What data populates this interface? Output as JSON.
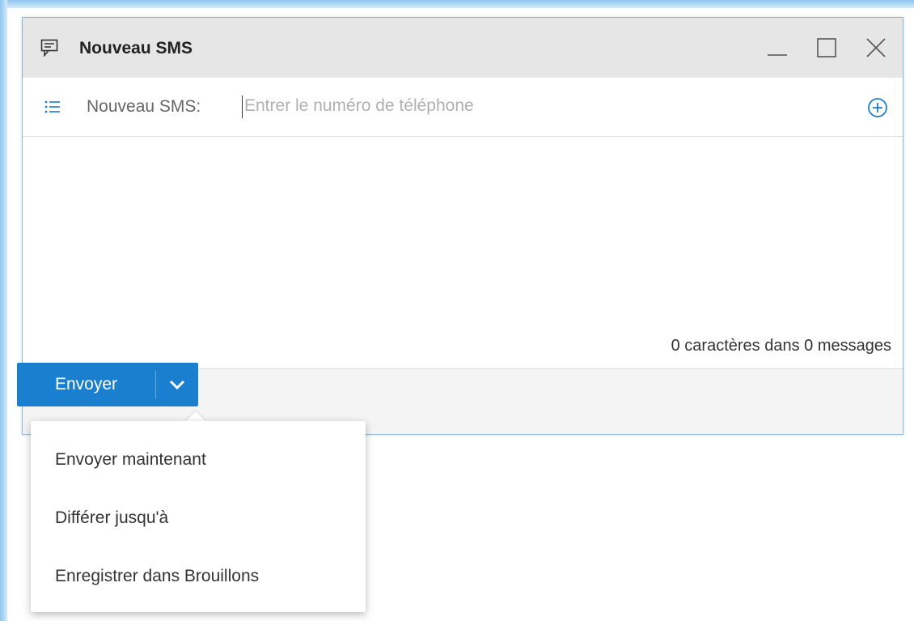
{
  "window": {
    "title": "Nouveau SMS",
    "title_icon": "sms-icon",
    "controls": [
      "minimize-icon",
      "maximize-icon",
      "close-icon"
    ]
  },
  "recipient": {
    "label": "Nouveau SMS:",
    "placeholder": "Entrer le numéro de téléphone",
    "value": "",
    "list_icon": "list-icon",
    "add_icon": "add-circle-icon"
  },
  "message": {
    "char_count": "0 caractères dans 0 messages"
  },
  "footer": {
    "send_label": "Envoyer",
    "dropdown_icon": "chevron-down-icon"
  },
  "send_menu": {
    "items": [
      {
        "label": "Envoyer maintenant"
      },
      {
        "label": "Différer jusqu'à"
      },
      {
        "label": "Enregistrer dans Brouillons"
      }
    ]
  },
  "colors": {
    "accent": "#1a7fcf",
    "titlebar": "#e6e6e6",
    "window_border": "#8bb8dc"
  }
}
